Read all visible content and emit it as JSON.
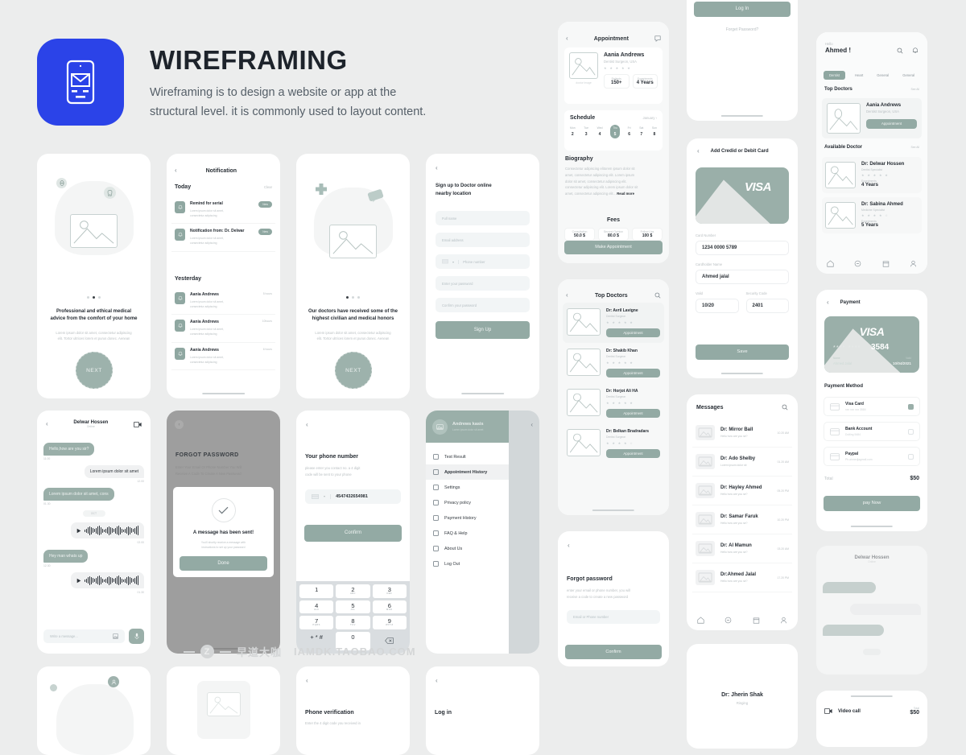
{
  "header": {
    "title": "WIREFRAMING",
    "subtitle_line1": "Wireframing is to design a website or app at the",
    "subtitle_line2": "structural level. it is commonly used to layout content.",
    "logo_icon": "mobile-envelope-icon",
    "brand_color": "#2b43e8"
  },
  "colors": {
    "accent_green": "#93aaa4",
    "canvas": "#eceded",
    "text": "#2b3137"
  },
  "onboarding_1": {
    "title_line1": "Professional and ethical medical",
    "title_line2": "advice from the comfort of your home",
    "body_line1": "Lorem ipsum dolor sit amet, consectetur adipiscing",
    "body_line2": "elit. Tortor ultrices lorem et purus donec. Aenean",
    "next_label": "NEXT",
    "active_dot": 1
  },
  "onboarding_2": {
    "title_line1": "Our doctors have received some of the",
    "title_line2": "highest civilian and medical honors",
    "body_line1": "Lorem ipsum dolor sit amet, consectetur adipiscing",
    "body_line2": "elit. Tortor ultrices lorem et purus donec. Aenean",
    "next_label": "NEXT",
    "active_dot": 0
  },
  "notification": {
    "title": "Notification",
    "today_label": "Today",
    "clear_label": "Clear",
    "yesterday_label": "Yesterday",
    "today_items": [
      {
        "title": "Remind for serial",
        "line1": "Lorem ipsum dolor sit amet,",
        "line2": "consectetur adipiscing",
        "tag": "New"
      },
      {
        "title": "Notification from: Dr. Delwar",
        "line1": "Lorem ipsum dolor sit amet,",
        "line2": "consectetur adipiscing",
        "tag": "New"
      }
    ],
    "yesterday_items": [
      {
        "title": "Aania Andrews",
        "line1": "Lorem ipsum dolor sit amet,",
        "line2": "consectetur adipiscing",
        "time": "5 hours"
      },
      {
        "title": "Aania Andrews",
        "line1": "Lorem ipsum dolor sit amet,",
        "line2": "consectetur adipiscing",
        "time": "10hours"
      },
      {
        "title": "Aania Andrews",
        "line1": "Lorem ipsum dolor sit amet,",
        "line2": "consectetur adipiscing",
        "time": "6 hours"
      }
    ]
  },
  "signup": {
    "title_line1": "Sign up to Doctor online",
    "title_line2": "nearby location",
    "fields": [
      {
        "placeholder": "Full name"
      },
      {
        "placeholder": "Email address"
      },
      {
        "placeholder": "Phone number",
        "prefix": "+1"
      },
      {
        "placeholder": "Enter your password"
      },
      {
        "placeholder": "Confirm your password"
      }
    ],
    "submit_label": "Sign Up"
  },
  "appointment": {
    "title": "Appointment",
    "doctor": {
      "name": "Aania Andrews",
      "specialty": "Dentist Surgeon, USA",
      "rating": 5,
      "image_caption": "doctor image",
      "stat1_label": "Patients",
      "stat1_value": "150+",
      "stat2_label": "Experiments",
      "stat2_value": "4 Years"
    },
    "schedule_label": "Schedule",
    "month_label": "January",
    "days": [
      {
        "d": "Mon",
        "n": "2"
      },
      {
        "d": "Tue",
        "n": "3"
      },
      {
        "d": "Wed",
        "n": "4"
      },
      {
        "d": "Thu",
        "n": "5",
        "selected": true
      },
      {
        "d": "Fri",
        "n": "6"
      },
      {
        "d": "Sat",
        "n": "7"
      },
      {
        "d": "Sun",
        "n": "8"
      }
    ],
    "biography_label": "Biography",
    "bio_lines": [
      "Consectetur adipiscing elitorem ipsum dolor sit",
      "amet, consectetur adipiscing elit. Lorem ipsum",
      "dolor sit amet, consectetur adipiscing elit.",
      "consectetur adipiscing elit. Lorem ipsum dolor sit",
      "amet, consectetur adipiscing elit..."
    ],
    "read_more": "Read more",
    "fees_label": "Fees",
    "fees": [
      {
        "label": "Consultation",
        "value": "50.0 $"
      },
      {
        "label": "Second Opinion",
        "value": "80.0 $"
      },
      {
        "label": "Follow Ups",
        "value": "100 $"
      }
    ],
    "cta_label": "Make Appointment"
  },
  "top_doctors": {
    "title": "Top Doctors",
    "search_icon": "search-icon",
    "items": [
      {
        "name": "Dr: Avril Lavigne",
        "specialty": "Dentist Surgeon",
        "rating": 5,
        "btn": "Appointment"
      },
      {
        "name": "Dr: Shakib Khan",
        "specialty": "Dentist Surgeon",
        "rating": 5,
        "btn": "Appointment"
      },
      {
        "name": "Dr: Horjot Ali HA",
        "specialty": "Dentist Surgeon",
        "rating": 5,
        "btn": "Appointment"
      },
      {
        "name": "Dr: Belkan Bradradars",
        "specialty": "Dentist Surgeon",
        "rating": 4,
        "btn": "Appointment"
      }
    ]
  },
  "forgot_password_small": {
    "title": "Forgot password",
    "line1": "enter your email or phone number, you will",
    "line2": "receive a code to create a new password",
    "placeholder": "Email or Phone number",
    "cta_label": "Confirm"
  },
  "login_top": {
    "login_label": "Log In",
    "forgot_label": "Forget Password?"
  },
  "add_card": {
    "title": "Add Credid or Debit Card",
    "brand": "VISA",
    "card_number_label": "Card Number",
    "card_number_value": "1234 0000 5789",
    "cardholder_label": "Cardholder Name",
    "cardholder_value": "Ahmed jalal",
    "valid_label": "Valid",
    "valid_value": "10/20",
    "security_label": "Security Code",
    "security_value": "2401",
    "save_label": "Save"
  },
  "messages": {
    "title": "Messages",
    "search_icon": "search-icon",
    "items": [
      {
        "name": "Dr: Mirror Ball",
        "preview": "Hello how are you sir?",
        "time": "10.20 AM"
      },
      {
        "name": "Dr: Ado Shelby",
        "preview": "Lorem ipsum dolor sit",
        "time": "01.20 AM"
      },
      {
        "name": "Dr: Hayley Ahmed",
        "preview": "Hello how are you sir?",
        "time": "05.20 PM"
      },
      {
        "name": "Dr: Samar Faruk",
        "preview": "Hello how are you sir?",
        "time": "10.20 PM"
      },
      {
        "name": "Dr: Al Mamun",
        "preview": "Hello how are you sir?",
        "time": "03.20 AM"
      },
      {
        "name": "Dr:Ahmed Jalal",
        "preview": "Hello how are you sir?",
        "time": "17.20 PM"
      }
    ],
    "tabs": [
      "home-icon",
      "chat-icon",
      "calendar-icon",
      "profile-icon"
    ]
  },
  "home": {
    "greeting": "Hello",
    "user": "Ahmed !",
    "search_icon": "search-icon",
    "bell_icon": "bell-icon",
    "categories": [
      {
        "label": "Dentist",
        "active": true
      },
      {
        "label": "Heart",
        "active": false
      },
      {
        "label": "General",
        "active": false
      },
      {
        "label": "General",
        "active": false
      }
    ],
    "top_doctors_label": "Top Doctors",
    "see_all_label": "See All",
    "featured": {
      "name": "Aania Andrews",
      "specialty": "Dentist Surgeon, USA",
      "btn": "Appointment"
    },
    "available_label": "Available Doctor",
    "available": [
      {
        "name": "Dr: Delwar Hossen",
        "specialty": "Dentist Specialist",
        "rating": 5,
        "exp_label": "Experiments",
        "exp_value": "4 Years"
      },
      {
        "name": "Dr: Sabina  Ahmed",
        "specialty": "Medicine Specialist",
        "rating": 4,
        "exp_label": "Experiments",
        "exp_value": "5 Years"
      }
    ],
    "tabs": [
      "home-icon",
      "chat-icon",
      "calendar-icon",
      "profile-icon"
    ]
  },
  "payment": {
    "title": "Payment",
    "brand": "VISA",
    "card_masked": "****  ****",
    "card_last4": "3584",
    "holder_label": "Name",
    "holder_value": "Ahmed Jalal",
    "valid_label": "Valid",
    "valid_value": "10/04/2021",
    "method_label": "Payment Method",
    "methods": [
      {
        "name": "Visa Card",
        "sub": "xxx  xxx  xxx  3584",
        "selected": true
      },
      {
        "name": "Bank Account",
        "sub": "Dutling 5484",
        "selected": false
      },
      {
        "name": "Paypal",
        "sub": "Ph.ahmedjagmail.com",
        "selected": false
      }
    ],
    "total_label": "Total",
    "total_value": "$50",
    "cta_label": "pay Now"
  },
  "chat": {
    "title": "Delwar Hossen",
    "status": "Online",
    "video_icon": "video-camera-icon",
    "date_chip": "OCT",
    "messages": [
      {
        "side": "left",
        "text": "Hello,how are you sir?",
        "time": "11.00"
      },
      {
        "side": "right",
        "text": "Lorem ipsum dolor sit amet",
        "time": "12.00"
      },
      {
        "side": "left",
        "text": "Lorem ipsum dolor sit amet, cons",
        "time": "01.30"
      },
      {
        "side": "right",
        "type": "audio",
        "time": "02.00"
      },
      {
        "side": "left",
        "text": "Hey man whats up",
        "time": "12.30"
      },
      {
        "side": "right",
        "type": "audio",
        "time": "01.30"
      }
    ],
    "input_placeholder": "Write  a message...",
    "attach_icon": "image-icon",
    "mic_icon": "microphone-icon"
  },
  "forgot_modal": {
    "title": "FORGOT PASSWORD",
    "line1": "Enter Your Email Or Phone Number You Will",
    "line2": "Receive A Code To Create A New Password",
    "modal_title": "A message has been sent!",
    "modal_line1": "You'll shortly receive a message with",
    "modal_line2": "instructions to set up your password",
    "done_label": "Done",
    "check_icon": "check-circle-icon"
  },
  "phone_number": {
    "title": "Your phone number",
    "line1": "please enter you contact no. a 4 digit",
    "line2": "code will be sent to your phone",
    "value": "4547432654981",
    "cta_label": "Confirm",
    "keys": [
      {
        "n": "1",
        "s": ""
      },
      {
        "n": "2",
        "s": "ABC"
      },
      {
        "n": "3",
        "s": "DEF"
      },
      {
        "n": "4",
        "s": "GHI"
      },
      {
        "n": "5",
        "s": "JKL"
      },
      {
        "n": "6",
        "s": "MNO"
      },
      {
        "n": "7",
        "s": "PQRS"
      },
      {
        "n": "8",
        "s": "TUV"
      },
      {
        "n": "9",
        "s": "WXYZ"
      },
      {
        "n": "+ * #",
        "s": ""
      },
      {
        "n": "0",
        "s": ""
      },
      {
        "n": "delete-icon",
        "s": ""
      }
    ]
  },
  "sidemenu": {
    "user_name": "Andrews kasis",
    "user_sub": "Lorem ipsum dolor sit amet",
    "items": [
      {
        "label": "Test Result",
        "icon": "flask-icon",
        "active": false
      },
      {
        "label": "Appointment History",
        "icon": "clock-icon",
        "active": true
      },
      {
        "label": "Settings",
        "icon": "gear-icon",
        "active": false
      },
      {
        "label": "Privacy policy",
        "icon": "shield-icon",
        "active": false
      },
      {
        "label": "Payment History",
        "icon": "card-icon",
        "active": false
      },
      {
        "label": "FAQ & Help",
        "icon": "question-icon",
        "active": false
      },
      {
        "label": "About Us",
        "icon": "info-icon",
        "active": false
      },
      {
        "label": "Log Out",
        "icon": "logout-icon",
        "active": false
      }
    ]
  },
  "phone_verification": {
    "title": "Phone verification",
    "line1": "Enter the 4 digit  code you received in"
  },
  "login_bottom": {
    "title": "Log in"
  },
  "calling": {
    "name": "Dr: Jherin Shak",
    "status": "Ringing"
  },
  "video_call_bar": {
    "label": "Video call",
    "total_label": "Total",
    "total_value": "$50",
    "icon": "video-camera-icon"
  },
  "watermark": {
    "text_cn": "早道大咖",
    "text_en": "IAMDK.TAOBAO.COM"
  }
}
